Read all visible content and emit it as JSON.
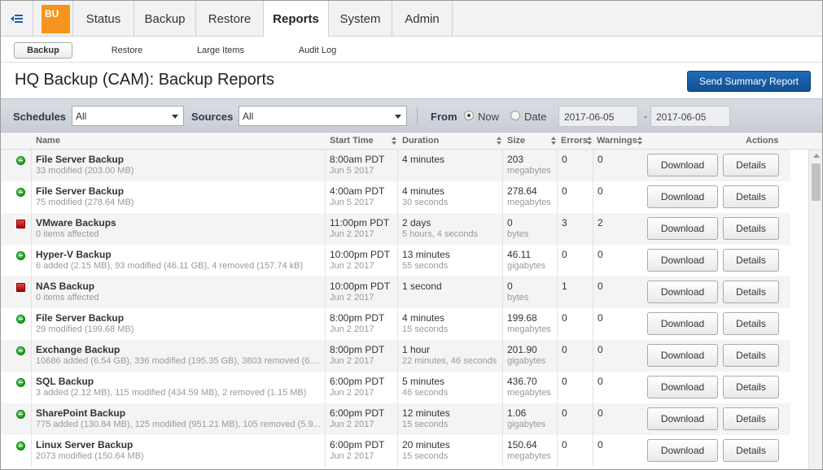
{
  "nav": {
    "logo": "BU",
    "tabs": [
      "Status",
      "Backup",
      "Restore",
      "Reports",
      "System",
      "Admin"
    ],
    "active_tab": "Reports"
  },
  "subnav": {
    "items": [
      "Backup",
      "Restore",
      "Large Items",
      "Audit Log"
    ],
    "active": "Backup"
  },
  "page": {
    "title": "HQ Backup (CAM): Backup Reports",
    "send_button": "Send Summary Report"
  },
  "filters": {
    "schedules_label": "Schedules",
    "schedules_value": "All",
    "sources_label": "Sources",
    "sources_value": "All",
    "from_label": "From",
    "now_label": "Now",
    "date_label": "Date",
    "date_mode": "Now",
    "date_start": "2017-06-05",
    "date_end": "2017-06-05",
    "date_sep": "-"
  },
  "table": {
    "columns": {
      "name": "Name",
      "start": "Start Time",
      "duration": "Duration",
      "size": "Size",
      "errors": "Errors",
      "warnings": "Warnings",
      "actions": "Actions"
    },
    "download_label": "Download",
    "details_label": "Details",
    "rows": [
      {
        "status": "ok",
        "name": "File Server Backup",
        "detail": "33 modified (203.00 MB)",
        "start": "8:00am PDT",
        "date": "Jun 5 2017",
        "duration": "4 minutes",
        "duration_detail": "",
        "size": "203",
        "size_unit": "megabytes",
        "errors": "0",
        "warnings": "0"
      },
      {
        "status": "ok",
        "name": "File Server Backup",
        "detail": "75 modified (278.64 MB)",
        "start": "4:00am PDT",
        "date": "Jun 5 2017",
        "duration": "4 minutes",
        "duration_detail": "30 seconds",
        "size": "278.64",
        "size_unit": "megabytes",
        "errors": "0",
        "warnings": "0"
      },
      {
        "status": "fail",
        "name": "VMware Backups",
        "detail": "0 items affected",
        "start": "11:00pm PDT",
        "date": "Jun 2 2017",
        "duration": "2 days",
        "duration_detail": "5 hours, 4 seconds",
        "size": "0",
        "size_unit": "bytes",
        "errors": "3",
        "warnings": "2"
      },
      {
        "status": "ok",
        "name": "Hyper-V Backup",
        "detail": "6 added (2.15 MB), 93 modified (46.11 GB), 4 removed (157.74 kB)",
        "start": "10:00pm PDT",
        "date": "Jun 2 2017",
        "duration": "13 minutes",
        "duration_detail": "55 seconds",
        "size": "46.11",
        "size_unit": "gigabytes",
        "errors": "0",
        "warnings": "0"
      },
      {
        "status": "fail",
        "name": "NAS Backup",
        "detail": "0 items affected",
        "start": "10:00pm PDT",
        "date": "Jun 2 2017",
        "duration": "1 second",
        "duration_detail": "",
        "size": "0",
        "size_unit": "bytes",
        "errors": "1",
        "warnings": "0"
      },
      {
        "status": "ok",
        "name": "File Server Backup",
        "detail": "29 modified (199.68 MB)",
        "start": "8:00pm PDT",
        "date": "Jun 2 2017",
        "duration": "4 minutes",
        "duration_detail": "15 seconds",
        "size": "199.68",
        "size_unit": "megabytes",
        "errors": "0",
        "warnings": "0"
      },
      {
        "status": "ok",
        "name": "Exchange Backup",
        "detail": "10686 added (6.54 GB), 336 modified (195.35 GB), 3803 removed (6....",
        "start": "8:00pm PDT",
        "date": "Jun 2 2017",
        "duration": "1 hour",
        "duration_detail": "22 minutes, 46 seconds",
        "size": "201.90",
        "size_unit": "gigabytes",
        "errors": "0",
        "warnings": "0"
      },
      {
        "status": "ok",
        "name": "SQL Backup",
        "detail": "3 added (2.12 MB), 115 modified (434.59 MB), 2 removed (1.15 MB)",
        "start": "6:00pm PDT",
        "date": "Jun 2 2017",
        "duration": "5 minutes",
        "duration_detail": "46 seconds",
        "size": "436.70",
        "size_unit": "megabytes",
        "errors": "0",
        "warnings": "0"
      },
      {
        "status": "ok",
        "name": "SharePoint Backup",
        "detail": "775 added (130.84 MB), 125 modified (951.21 MB), 105 removed (5.9...",
        "start": "6:00pm PDT",
        "date": "Jun 2 2017",
        "duration": "12 minutes",
        "duration_detail": "15 seconds",
        "size": "1.06",
        "size_unit": "gigabytes",
        "errors": "0",
        "warnings": "0"
      },
      {
        "status": "ok",
        "name": "Linux Server Backup",
        "detail": "2073 modified (150.64 MB)",
        "start": "6:00pm PDT",
        "date": "Jun 2 2017",
        "duration": "20 minutes",
        "duration_detail": "15 seconds",
        "size": "150.64",
        "size_unit": "megabytes",
        "errors": "0",
        "warnings": "0"
      }
    ]
  },
  "colors": {
    "accent": "#1a5ea8",
    "logo": "#f7941d",
    "status_ok": "#1fa31f",
    "status_fail": "#cc1f1f"
  }
}
